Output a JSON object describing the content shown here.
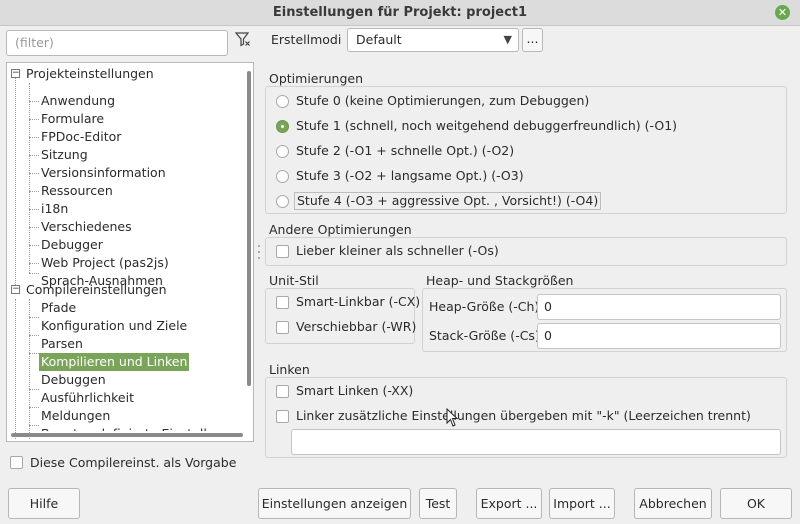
{
  "window": {
    "title": "Einstellungen für Projekt: project1"
  },
  "filter": {
    "placeholder": "(filter)"
  },
  "tree": {
    "groups": [
      {
        "label": "Projekteinstellungen",
        "items": [
          "Anwendung",
          "Formulare",
          "FPDoc-Editor",
          "Sitzung",
          "Versionsinformation",
          "Ressourcen",
          "i18n",
          "Verschiedenes",
          "Debugger",
          "Web Project (pas2js)",
          "Sprach-Ausnahmen"
        ]
      },
      {
        "label": "Compilereinstellungen",
        "items": [
          "Pfade",
          "Konfiguration und Ziele",
          "Parsen",
          "Kompilieren und Linken",
          "Debuggen",
          "Ausführlichkeit",
          "Meldungen",
          "Benutzerdefinierte Einstell"
        ]
      }
    ],
    "selected": "Kompilieren und Linken"
  },
  "default_checkbox": {
    "label": "Diese Compilereinst. als Vorgabe"
  },
  "build_mode": {
    "label": "Erstellmodi",
    "value": "Default",
    "more_label": "..."
  },
  "optimizations": {
    "title": "Optimierungen",
    "options": [
      "Stufe 0 (keine Optimierungen, zum Debuggen)",
      "Stufe 1 (schnell, noch weitgehend debuggerfreundlich) (-O1)",
      "Stufe 2 (-O1 + schnelle Opt.) (-O2)",
      "Stufe 3 (-O2 + langsame Opt.) (-O3)",
      "Stufe 4 (-O3 + aggressive Opt. , Vorsicht!) (-O4)"
    ],
    "selected_index": 1
  },
  "other_optimizations": {
    "title": "Andere Optimierungen",
    "smaller": "Lieber kleiner als schneller (-Os)"
  },
  "unit_style": {
    "title": "Unit-Stil",
    "smartlink": "Smart-Linkbar (-CX)",
    "relocatable": "Verschiebbar (-WR)"
  },
  "heap_stack": {
    "title": "Heap- und Stackgrößen",
    "heap_label": "Heap-Größe (-Ch)",
    "heap_value": "0",
    "stack_label": "Stack-Größe (-Cs)",
    "stack_value": "0"
  },
  "linking": {
    "title": "Linken",
    "smart": "Smart Linken (-XX)",
    "extra": "Linker zusätzliche Einstellungen übergeben mit  \"-k\" (Leerzeichen trennt)",
    "extra_value": ""
  },
  "buttons": {
    "help": "Hilfe",
    "show_options": "Einstellungen anzeigen",
    "test": "Test",
    "export": "Export ...",
    "import": "Import ...",
    "cancel": "Abbrechen",
    "ok": "OK"
  },
  "colors": {
    "accent": "#7aa45a"
  }
}
